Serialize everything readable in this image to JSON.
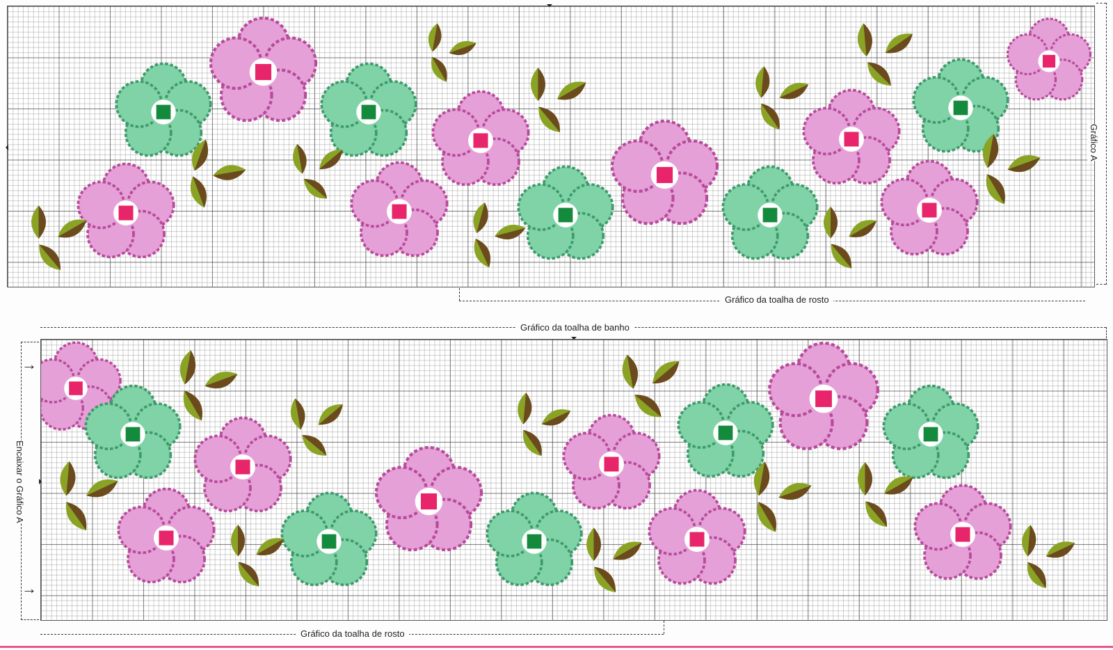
{
  "labels": {
    "top_face_towel": "Gráfico da toalha de rosto",
    "bath_towel": "Gráfico da toalha de banho",
    "bottom_face_towel": "Gráfico da toalha de rosto",
    "chart_a": "Gráfico A",
    "fit_chart_a": "Encaixar o Gráfico A"
  },
  "colors": {
    "pink_petal": "#e5a0d8",
    "pink_shade": "#b84a9a",
    "pink_center": "#e8246a",
    "mint_petal": "#7fd3a7",
    "mint_shade": "#3e9a6a",
    "mint_center": "#138a3c",
    "leaf_light": "#8aa324",
    "leaf_dark": "#6b4a1e",
    "accent_rule": "#e9568e"
  },
  "icons": [
    "arrow-right-icon",
    "diamond-marker-icon"
  ]
}
